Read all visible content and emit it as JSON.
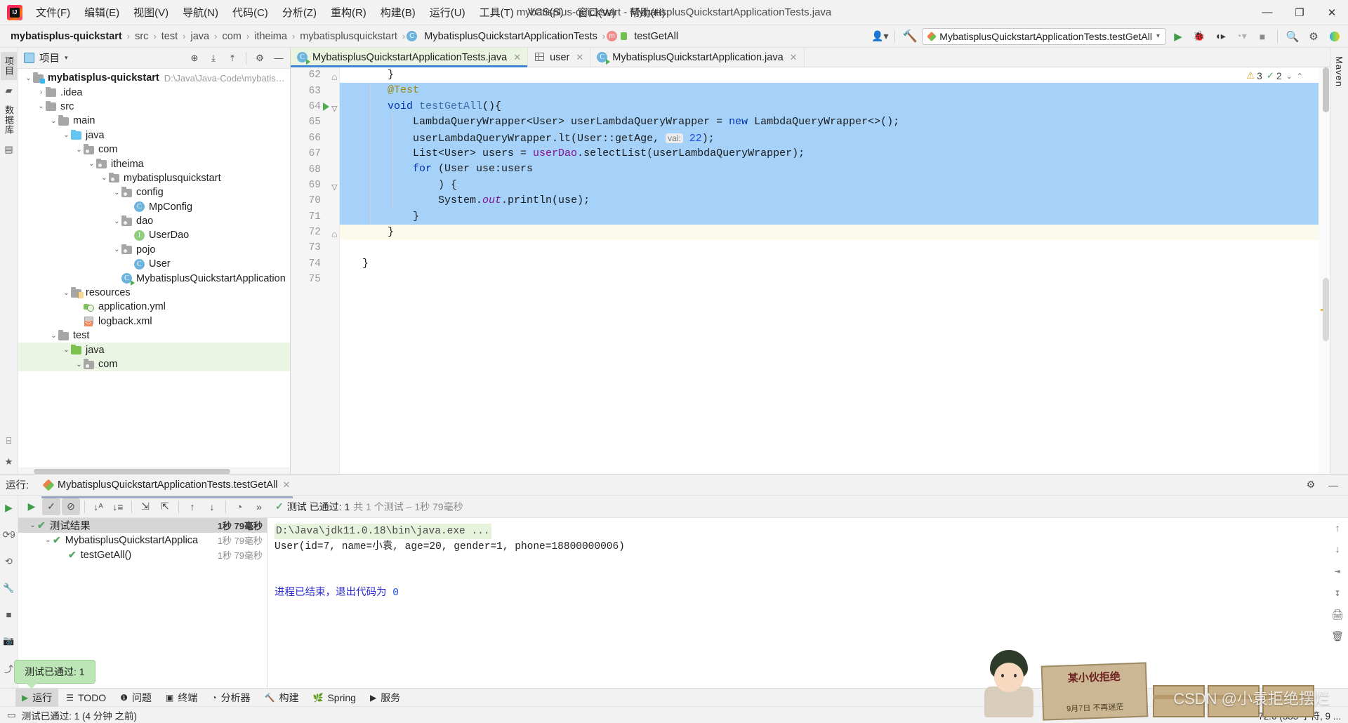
{
  "window": {
    "title": "mybatisplus-quickstart - MybatisplusQuickstartApplicationTests.java",
    "minimize": "—",
    "maximize": "❐",
    "close": "✕"
  },
  "menu": [
    {
      "label": "文件(F)"
    },
    {
      "label": "编辑(E)"
    },
    {
      "label": "视图(V)"
    },
    {
      "label": "导航(N)"
    },
    {
      "label": "代码(C)"
    },
    {
      "label": "分析(Z)"
    },
    {
      "label": "重构(R)"
    },
    {
      "label": "构建(B)"
    },
    {
      "label": "运行(U)"
    },
    {
      "label": "工具(T)"
    },
    {
      "label": "VCS(S)"
    },
    {
      "label": "窗口(W)"
    },
    {
      "label": "帮助(H)"
    }
  ],
  "breadcrumb": [
    {
      "label": "mybatisplus-quickstart"
    },
    {
      "label": "src"
    },
    {
      "label": "test"
    },
    {
      "label": "java"
    },
    {
      "label": "com"
    },
    {
      "label": "itheima"
    },
    {
      "label": "mybatisplusquickstart"
    },
    {
      "label": "MybatisplusQuickstartApplicationTests"
    },
    {
      "label": "testGetAll"
    }
  ],
  "run_config": {
    "name": "MybatisplusQuickstartApplicationTests.testGetAll",
    "dropdown_caret": "▾"
  },
  "rail_left": {
    "project_label": "项目",
    "database_label": "数据库"
  },
  "rail_right": {
    "maven_label": "Maven"
  },
  "project_panel": {
    "title": "项目",
    "caret": "▾",
    "tree": [
      {
        "depth": 0,
        "arrow": "⌄",
        "icon": "module-folder",
        "label": "mybatisplus-quickstart",
        "bold": true,
        "path": "D:\\Java\\Java-Code\\mybatisplus-qu",
        "highlight": false
      },
      {
        "depth": 1,
        "arrow": "›",
        "icon": "folder-grey",
        "label": ".idea",
        "bold": false,
        "path": "",
        "highlight": false
      },
      {
        "depth": 1,
        "arrow": "⌄",
        "icon": "folder-grey",
        "label": "src",
        "bold": false,
        "path": "",
        "highlight": false
      },
      {
        "depth": 2,
        "arrow": "⌄",
        "icon": "folder-grey",
        "label": "main",
        "bold": false,
        "path": "",
        "highlight": false
      },
      {
        "depth": 3,
        "arrow": "⌄",
        "icon": "folder-blue",
        "label": "java",
        "bold": false,
        "path": "",
        "highlight": false
      },
      {
        "depth": 4,
        "arrow": "⌄",
        "icon": "package",
        "label": "com",
        "bold": false,
        "path": "",
        "highlight": false
      },
      {
        "depth": 5,
        "arrow": "⌄",
        "icon": "package",
        "label": "itheima",
        "bold": false,
        "path": "",
        "highlight": false
      },
      {
        "depth": 6,
        "arrow": "⌄",
        "icon": "package",
        "label": "mybatisplusquickstart",
        "bold": false,
        "path": "",
        "highlight": false
      },
      {
        "depth": 7,
        "arrow": "⌄",
        "icon": "package",
        "label": "config",
        "bold": false,
        "path": "",
        "highlight": false
      },
      {
        "depth": 8,
        "arrow": "",
        "icon": "class",
        "label": "MpConfig",
        "bold": false,
        "path": "",
        "highlight": false
      },
      {
        "depth": 7,
        "arrow": "⌄",
        "icon": "package",
        "label": "dao",
        "bold": false,
        "path": "",
        "highlight": false
      },
      {
        "depth": 8,
        "arrow": "",
        "icon": "interface",
        "label": "UserDao",
        "bold": false,
        "path": "",
        "highlight": false
      },
      {
        "depth": 7,
        "arrow": "⌄",
        "icon": "package",
        "label": "pojo",
        "bold": false,
        "path": "",
        "highlight": false
      },
      {
        "depth": 8,
        "arrow": "",
        "icon": "class",
        "label": "User",
        "bold": false,
        "path": "",
        "highlight": false
      },
      {
        "depth": 7,
        "arrow": "",
        "icon": "class-runnable",
        "label": "MybatisplusQuickstartApplication",
        "bold": false,
        "path": "",
        "highlight": false
      },
      {
        "depth": 3,
        "arrow": "⌄",
        "icon": "folder-resources",
        "label": "resources",
        "bold": false,
        "path": "",
        "highlight": false
      },
      {
        "depth": 4,
        "arrow": "",
        "icon": "yml",
        "label": "application.yml",
        "bold": false,
        "path": "",
        "highlight": false
      },
      {
        "depth": 4,
        "arrow": "",
        "icon": "xml",
        "label": "logback.xml",
        "bold": false,
        "path": "",
        "highlight": false
      },
      {
        "depth": 2,
        "arrow": "⌄",
        "icon": "folder-grey",
        "label": "test",
        "bold": false,
        "path": "",
        "highlight": false
      },
      {
        "depth": 3,
        "arrow": "⌄",
        "icon": "folder-green",
        "label": "java",
        "bold": false,
        "path": "",
        "highlight": true
      },
      {
        "depth": 4,
        "arrow": "⌄",
        "icon": "package",
        "label": "com",
        "bold": false,
        "path": "",
        "highlight": true
      }
    ]
  },
  "editor": {
    "tabs": [
      {
        "label": "MybatisplusQuickstartApplicationTests.java",
        "icon": "class-test",
        "active": true,
        "close": "✕"
      },
      {
        "label": "user",
        "icon": "table",
        "active": false,
        "close": "✕"
      },
      {
        "label": "MybatisplusQuickstartApplication.java",
        "icon": "class-runnable",
        "active": false,
        "close": "✕"
      }
    ],
    "badges": {
      "warning_icon": "⚠",
      "warning_count": "3",
      "check_icon": "✓",
      "check_count": "2",
      "chevron": "⌄",
      "collapse": "⌃"
    },
    "first_line_number": 62,
    "lines": [
      {
        "n": 62,
        "sel": false,
        "caret": false,
        "gutter": "fold-end",
        "tokens": [
          {
            "t": "    }",
            "c": ""
          }
        ]
      },
      {
        "n": 63,
        "sel": true,
        "caret": false,
        "gutter": "",
        "tokens": [
          {
            "t": "    ",
            "c": ""
          },
          {
            "t": "@Test",
            "c": "ann"
          }
        ]
      },
      {
        "n": 64,
        "sel": true,
        "caret": false,
        "gutter": "run-fold",
        "tokens": [
          {
            "t": "    ",
            "c": ""
          },
          {
            "t": "void ",
            "c": "kw"
          },
          {
            "t": "testGetAll",
            "c": "meth"
          },
          {
            "t": "(){",
            "c": ""
          }
        ]
      },
      {
        "n": 65,
        "sel": true,
        "caret": false,
        "gutter": "",
        "tokens": [
          {
            "t": "        LambdaQueryWrapper<User> userLambdaQueryWrapper = ",
            "c": ""
          },
          {
            "t": "new ",
            "c": "kw"
          },
          {
            "t": "LambdaQueryWrapper<>();",
            "c": ""
          }
        ]
      },
      {
        "n": 66,
        "sel": true,
        "caret": false,
        "gutter": "",
        "tokens": [
          {
            "t": "        userLambdaQueryWrapper.lt(User::getAge, ",
            "c": ""
          },
          {
            "t": "val:",
            "c": "hint"
          },
          {
            "t": " ",
            "c": ""
          },
          {
            "t": "22",
            "c": "num"
          },
          {
            "t": ");",
            "c": ""
          }
        ]
      },
      {
        "n": 67,
        "sel": true,
        "caret": false,
        "gutter": "",
        "tokens": [
          {
            "t": "        List<User> users = ",
            "c": ""
          },
          {
            "t": "userDao",
            "c": "fld"
          },
          {
            "t": ".selectList(userLambdaQueryWrapper);",
            "c": ""
          }
        ]
      },
      {
        "n": 68,
        "sel": true,
        "caret": false,
        "gutter": "",
        "tokens": [
          {
            "t": "        ",
            "c": ""
          },
          {
            "t": "for ",
            "c": "kw"
          },
          {
            "t": "(User use:users",
            "c": ""
          }
        ]
      },
      {
        "n": 69,
        "sel": true,
        "caret": false,
        "gutter": "fold",
        "tokens": [
          {
            "t": "            ) {",
            "c": ""
          }
        ]
      },
      {
        "n": 70,
        "sel": true,
        "caret": false,
        "gutter": "",
        "tokens": [
          {
            "t": "            System.",
            "c": ""
          },
          {
            "t": "out",
            "c": "stat"
          },
          {
            "t": ".println(use);",
            "c": ""
          }
        ]
      },
      {
        "n": 71,
        "sel": true,
        "caret": false,
        "gutter": "",
        "tokens": [
          {
            "t": "        }",
            "c": ""
          }
        ]
      },
      {
        "n": 72,
        "sel": false,
        "caret": true,
        "gutter": "fold-end",
        "tokens": [
          {
            "t": "    }",
            "c": ""
          }
        ]
      },
      {
        "n": 73,
        "sel": false,
        "caret": false,
        "gutter": "",
        "tokens": [
          {
            "t": "",
            "c": ""
          }
        ]
      },
      {
        "n": 74,
        "sel": false,
        "caret": false,
        "gutter": "",
        "tokens": [
          {
            "t": "}",
            "c": ""
          }
        ]
      },
      {
        "n": 75,
        "sel": false,
        "caret": false,
        "gutter": "",
        "tokens": [
          {
            "t": "",
            "c": ""
          }
        ]
      }
    ]
  },
  "run_panel": {
    "label": "运行:",
    "tab": "MybatisplusQuickstartApplicationTests.testGetAll",
    "tab_close": "✕",
    "settings_icon": "⚙",
    "hide_icon": "—",
    "toolbar": [
      {
        "name": "rerun",
        "glyph": "▶",
        "active": false
      },
      {
        "name": "show-passed",
        "glyph": "✓",
        "active": true
      },
      {
        "name": "show-ignored",
        "glyph": "⊘",
        "active": true
      },
      {
        "name": "sort-alpha",
        "glyph": "↓ᴬ",
        "active": false
      },
      {
        "name": "sort-duration",
        "glyph": "↓≡",
        "active": false
      },
      {
        "name": "expand-all",
        "glyph": "⇲",
        "active": false
      },
      {
        "name": "collapse-all",
        "glyph": "⇱",
        "active": false
      },
      {
        "name": "prev-failed",
        "glyph": "↑",
        "active": false
      },
      {
        "name": "next-failed",
        "glyph": "↓",
        "active": false
      },
      {
        "name": "history",
        "glyph": "◔",
        "active": false
      },
      {
        "name": "more",
        "glyph": "»",
        "active": false
      }
    ],
    "status_check": "✓",
    "status_text": "测试 已通过: 1",
    "status_dim": "共 1 个测试 – 1秒 79毫秒",
    "test_tree": [
      {
        "depth": 0,
        "arrow": "⌄",
        "label": "测试结果",
        "duration": "1秒 79毫秒",
        "selected": true
      },
      {
        "depth": 1,
        "arrow": "⌄",
        "label": "MybatisplusQuickstartApplica",
        "duration": "1秒 79毫秒",
        "selected": false
      },
      {
        "depth": 2,
        "arrow": "",
        "label": "testGetAll()",
        "duration": "1秒 79毫秒",
        "selected": false
      }
    ],
    "console": {
      "command": "D:\\Java\\jdk11.0.18\\bin\\java.exe ...",
      "output": "User(id=7, name=小袁, age=20, gender=1, phone=18800000006)",
      "exit_text": "进程已结束，退出代码为",
      "exit_code": "0"
    },
    "console_side_icons": [
      "↑",
      "↓",
      "⇥",
      "↧",
      "🖨",
      "🗑"
    ]
  },
  "balloon": {
    "text": "测试已通过: 1"
  },
  "bottom_bar": [
    {
      "label": "运行",
      "icon": "▶",
      "active": true
    },
    {
      "label": "TODO",
      "icon": "☰",
      "active": false
    },
    {
      "label": "问题",
      "icon": "❶",
      "active": false
    },
    {
      "label": "终端",
      "icon": "▣",
      "active": false
    },
    {
      "label": "分析器",
      "icon": "◔",
      "active": false
    },
    {
      "label": "构建",
      "icon": "🔨",
      "active": false
    },
    {
      "label": "Spring",
      "icon": "🌿",
      "active": false
    },
    {
      "label": "服务",
      "icon": "▶",
      "active": false
    }
  ],
  "status_bar": {
    "left_icon": "▭",
    "left_text": "测试已通过: 1 (4 分钟 之前)",
    "caret_position": "72:6 (335 字符, 9 ..."
  },
  "watermark": {
    "text": "CSDN @小袁拒绝摆烂",
    "banner_title": "某小伙拒绝",
    "banner_sub": "9月7日 不再迷茫"
  }
}
